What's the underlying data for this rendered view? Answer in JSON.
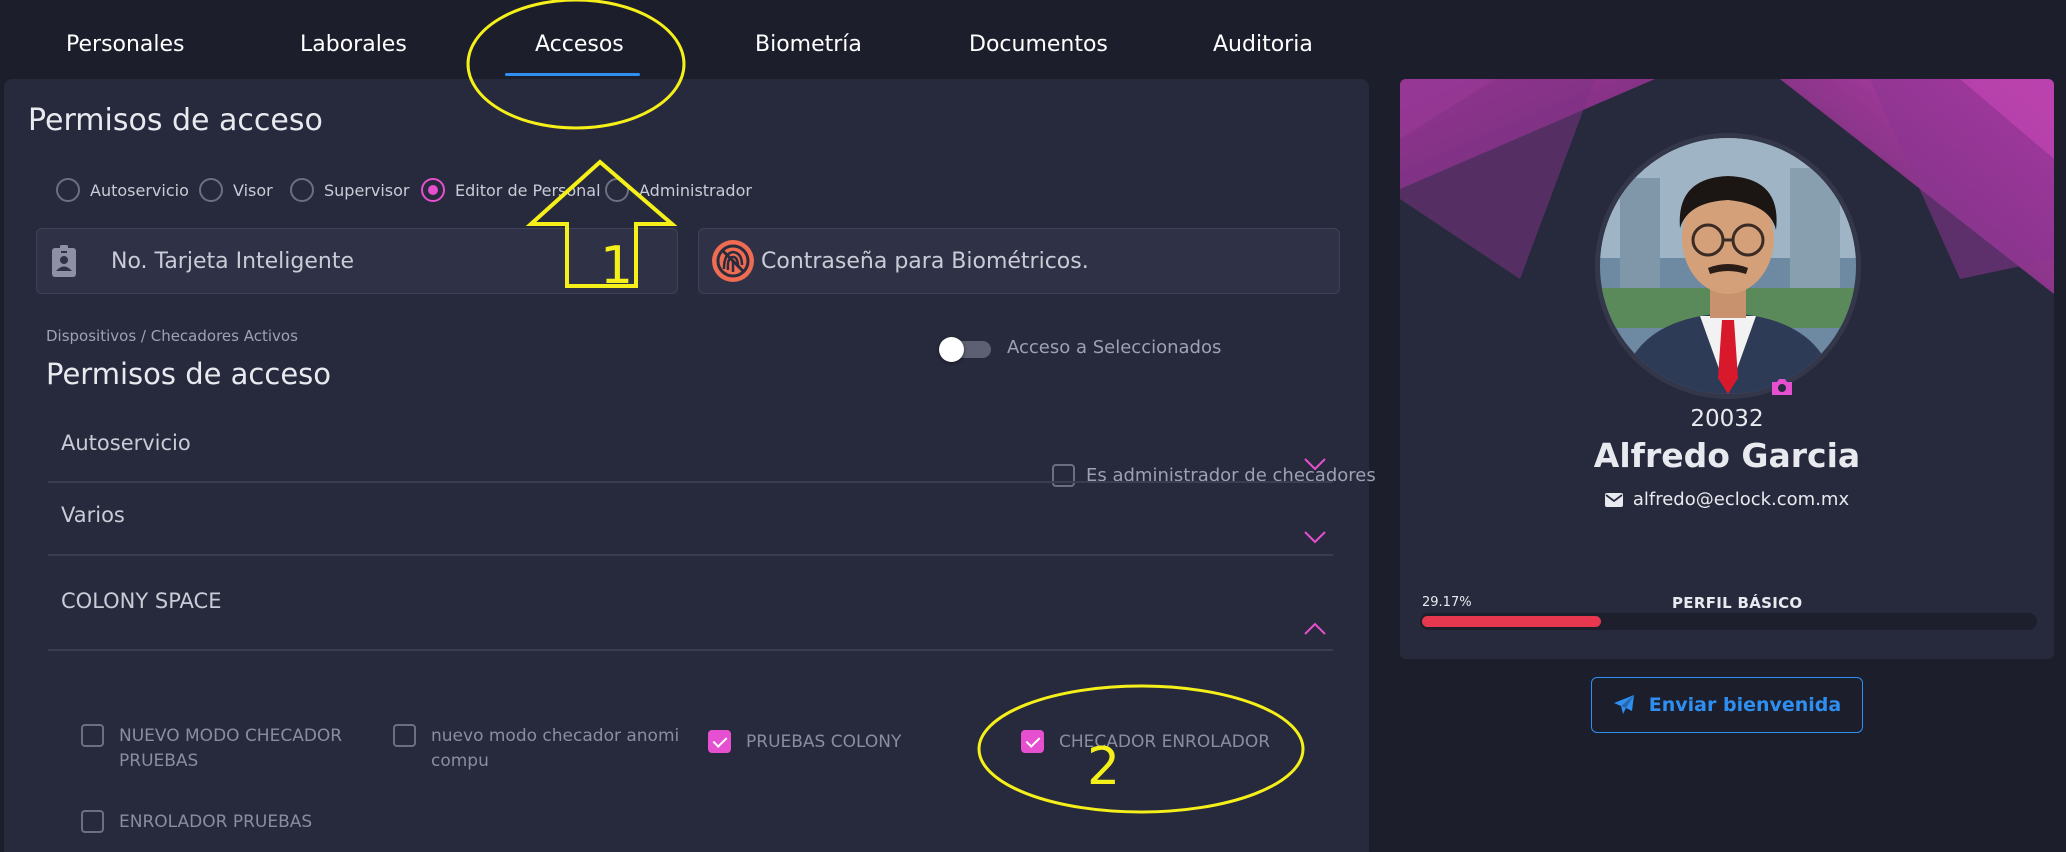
{
  "tabs": [
    "Personales",
    "Laborales",
    "Accesos",
    "Biometría",
    "Documentos",
    "Auditoria"
  ],
  "panel": {
    "title": "Permisos de acceso",
    "roles": [
      {
        "label": "Autoservicio",
        "selected": false
      },
      {
        "label": "Visor",
        "selected": false
      },
      {
        "label": "Supervisor",
        "selected": false
      },
      {
        "label": "Editor de Personal",
        "selected": true
      },
      {
        "label": "Administrador",
        "selected": false
      }
    ],
    "smartcard_placeholder": "No. Tarjeta Inteligente",
    "biometric_password_placeholder": "Contraseña para Biométricos.",
    "devices_breadcrumb": "Dispositivos / Checadores Activos",
    "devices_title": "Permisos de acceso",
    "access_selected_label": "Acceso a Seleccionados",
    "access_selected_on": false,
    "is_admin_label": "Es administrador de checadores",
    "accordions": [
      {
        "title": "Autoservicio",
        "expanded": false
      },
      {
        "title": "Varios",
        "expanded": false
      },
      {
        "title": "COLONY SPACE",
        "expanded": true
      }
    ],
    "colony_items": [
      {
        "label": "NUEVO MODO CHECADOR PRUEBAS",
        "checked": false
      },
      {
        "label": "nuevo modo checador anomi compu",
        "checked": false
      },
      {
        "label": "PRUEBAS COLONY",
        "checked": true
      },
      {
        "label": "CHECADOR ENROLADOR",
        "checked": true
      },
      {
        "label": "ENROLADOR PRUEBAS",
        "checked": false
      }
    ]
  },
  "profile": {
    "employee_id": "20032",
    "name": "Alfredo Garcia",
    "email": "alfredo@eclock.com.mx",
    "progress_label": "29.17%",
    "progress_value": 29.17,
    "profile_level": "PERFIL BÁSICO",
    "welcome_button": "Enviar bienvenida"
  },
  "annotations": {
    "step1": "1",
    "step2": "2"
  },
  "colors": {
    "accent": "#e64fd0",
    "link": "#2f8ff0",
    "progress": "#e8384f",
    "annotation": "#f5f019",
    "background": "#1c1e2c",
    "panel": "#272a3c"
  },
  "icons": [
    "id-badge-icon",
    "no-fingerprint-icon",
    "chevron-down-icon",
    "chevron-up-icon",
    "camera-icon",
    "envelope-icon",
    "paper-plane-icon"
  ]
}
